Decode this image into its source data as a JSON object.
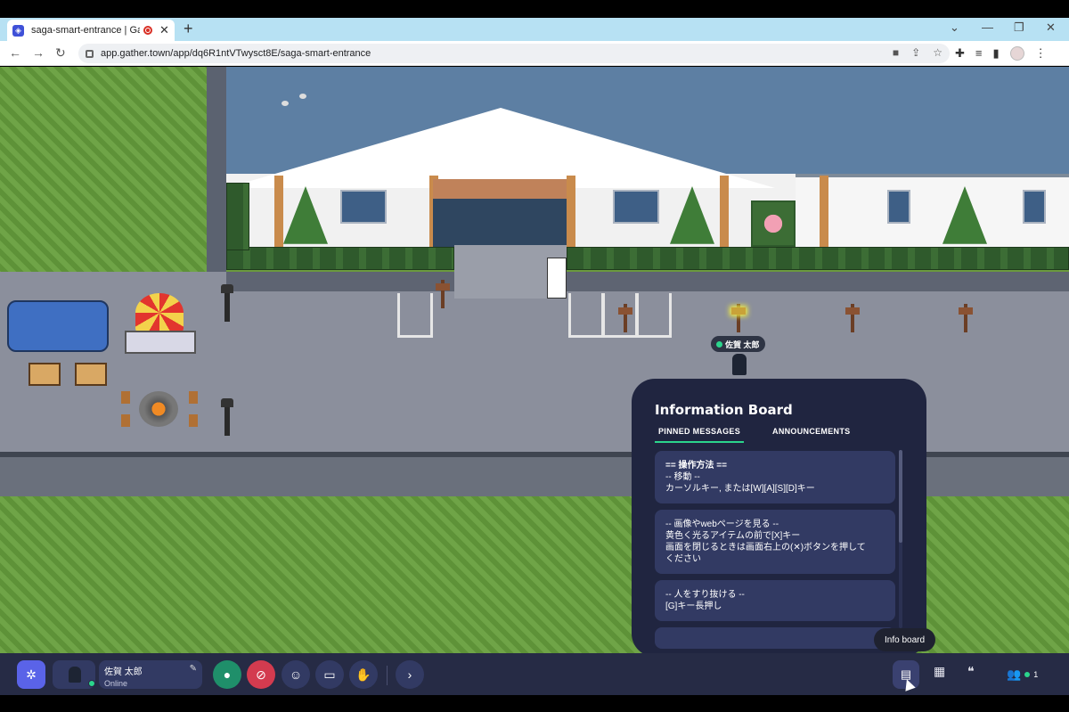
{
  "browser": {
    "tab_title": "saga-smart-entrance | Gathe",
    "tab_close": "✕",
    "new_tab": "+",
    "url": "app.gather.town/app/dq6R1ntVTwysct8E/saga-smart-entrance",
    "window_controls": [
      "⌄",
      "—",
      "❐",
      "✕"
    ]
  },
  "game": {
    "player_name": "佐賀 太郎"
  },
  "info_board": {
    "title": "Information Board",
    "tabs": [
      {
        "label": "PINNED MESSAGES",
        "active": true
      },
      {
        "label": "ANNOUNCEMENTS",
        "active": false
      }
    ],
    "messages": [
      {
        "lines": [
          "== 操作方法 ==",
          "-- 移動 --",
          "カーソルキー, または[W][A][S][D]キー"
        ]
      },
      {
        "lines": [
          "-- 画像やwebページを見る --",
          "黄色く光るアイテムの前で[X]キー",
          "画面を閉じるときは画面右上の(✕)ボタンを押して",
          "ください"
        ]
      },
      {
        "lines": [
          "-- 人をすり抜ける --",
          "[G]キー長押し"
        ]
      }
    ]
  },
  "tooltip": "Info board",
  "bottom_bar": {
    "user_name": "佐賀 太郎",
    "user_status": "Online",
    "participant_count": "1"
  },
  "colors": {
    "accent_green": "#2bd58c",
    "panel_bg": "#202540",
    "bar_bg": "#262b45",
    "brand": "#5a63e8"
  }
}
